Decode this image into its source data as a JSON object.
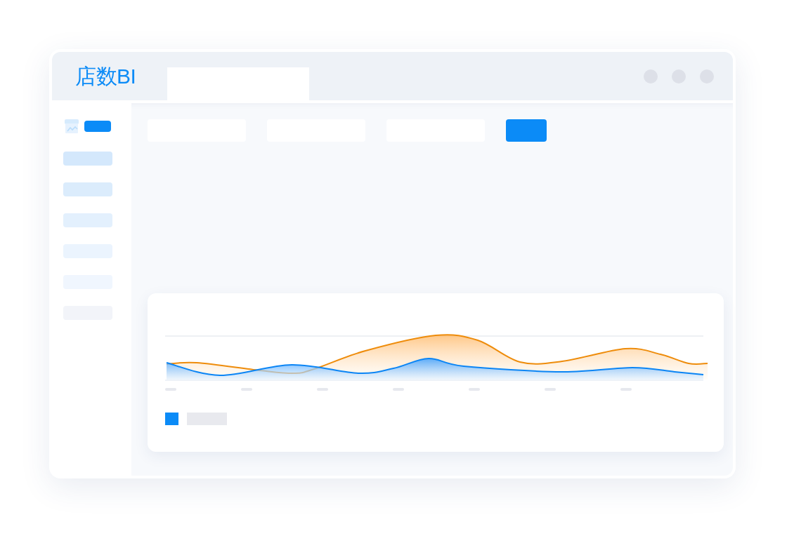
{
  "window": {
    "title": "店数BI"
  }
}
